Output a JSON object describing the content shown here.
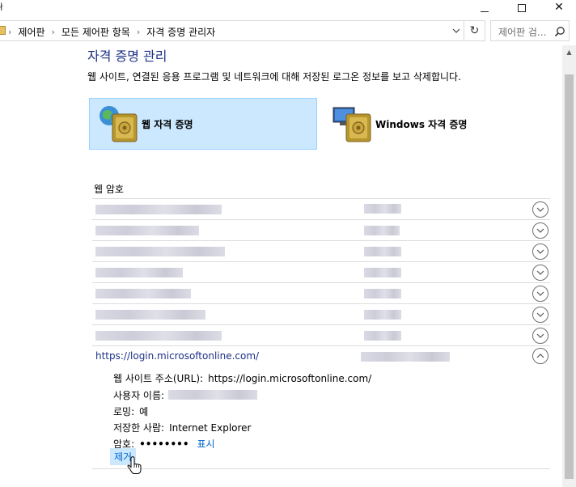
{
  "window": {
    "title_fragment": "ł"
  },
  "address_bar": {
    "breadcrumbs": [
      "제어판",
      "모든 제어판 항목",
      "자격 증명 관리자"
    ],
    "search_placeholder": "제어판 검..."
  },
  "page": {
    "title": "자격 증명 관리",
    "description": "웹 사이트, 연결된 응용 프로그램 및 네트워크에 대해 저장된 로그온 정보를 보고 삭제합니다."
  },
  "tiles": [
    {
      "label": "웹 자격 증명",
      "selected": true
    },
    {
      "label": "Windows 자격 증명",
      "selected": false
    }
  ],
  "section": {
    "label": "웹 암호"
  },
  "expanded_entry": {
    "url": "https://login.microsoftonline.com/",
    "site_label": "웹 사이트 주소(URL):",
    "site_value": "https://login.microsoftonline.com/",
    "user_label": "사용자 이름:",
    "roaming_label": "로밍:",
    "roaming_value": "예",
    "saved_by_label": "저장한 사람:",
    "saved_by_value": "Internet Explorer",
    "password_label": "암호:",
    "password_value": "••••••••",
    "show_label": "표시",
    "remove_label": "제거"
  },
  "colors": {
    "title_blue": "#1e3287",
    "link_blue": "#0066cc",
    "tile_selected_bg": "#cce8ff"
  }
}
